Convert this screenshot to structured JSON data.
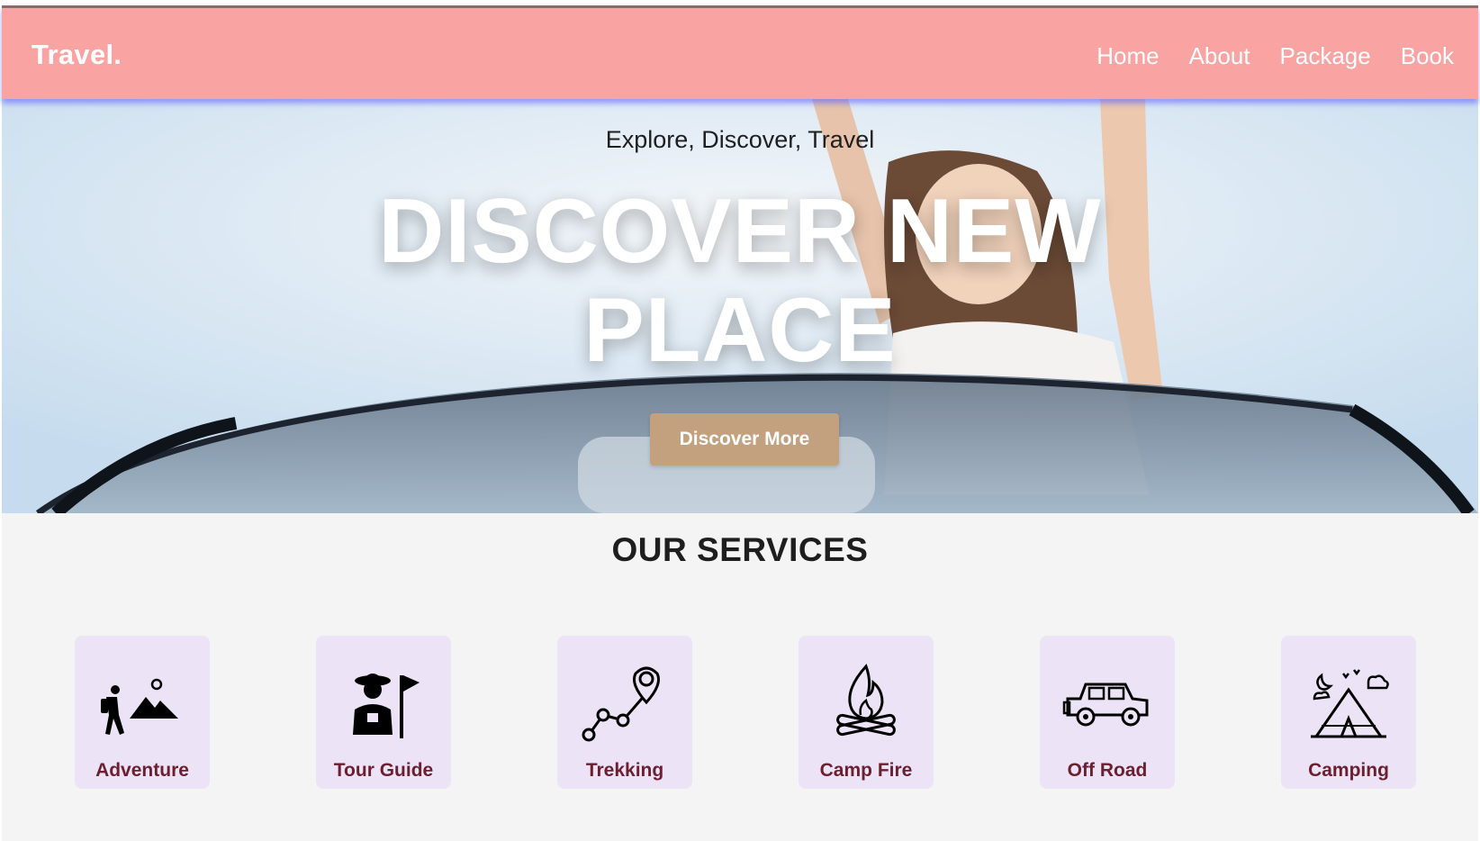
{
  "brand": {
    "logo": "Travel.",
    "navbar_color": "#f9a3a3"
  },
  "nav": {
    "items": [
      "Home",
      "About",
      "Package",
      "Book"
    ]
  },
  "hero": {
    "tagline": "Explore, Discover, Travel",
    "title_line1": "DISCOVER NEW",
    "title_line2": "PLACE",
    "button_label": "Discover More",
    "button_color": "#c3a17f"
  },
  "services": {
    "title": "OUR SERVICES",
    "items": [
      {
        "label": "Adventure",
        "icon": "hiker-mountain-icon"
      },
      {
        "label": "Tour Guide",
        "icon": "tour-guide-flag-icon"
      },
      {
        "label": "Trekking",
        "icon": "trekking-route-pin-icon"
      },
      {
        "label": "Camp Fire",
        "icon": "campfire-icon"
      },
      {
        "label": "Off Road",
        "icon": "off-road-jeep-icon"
      },
      {
        "label": "Camping",
        "icon": "camping-tent-icon"
      }
    ],
    "card_color": "#ece3f6",
    "label_color": "#6b2030"
  }
}
